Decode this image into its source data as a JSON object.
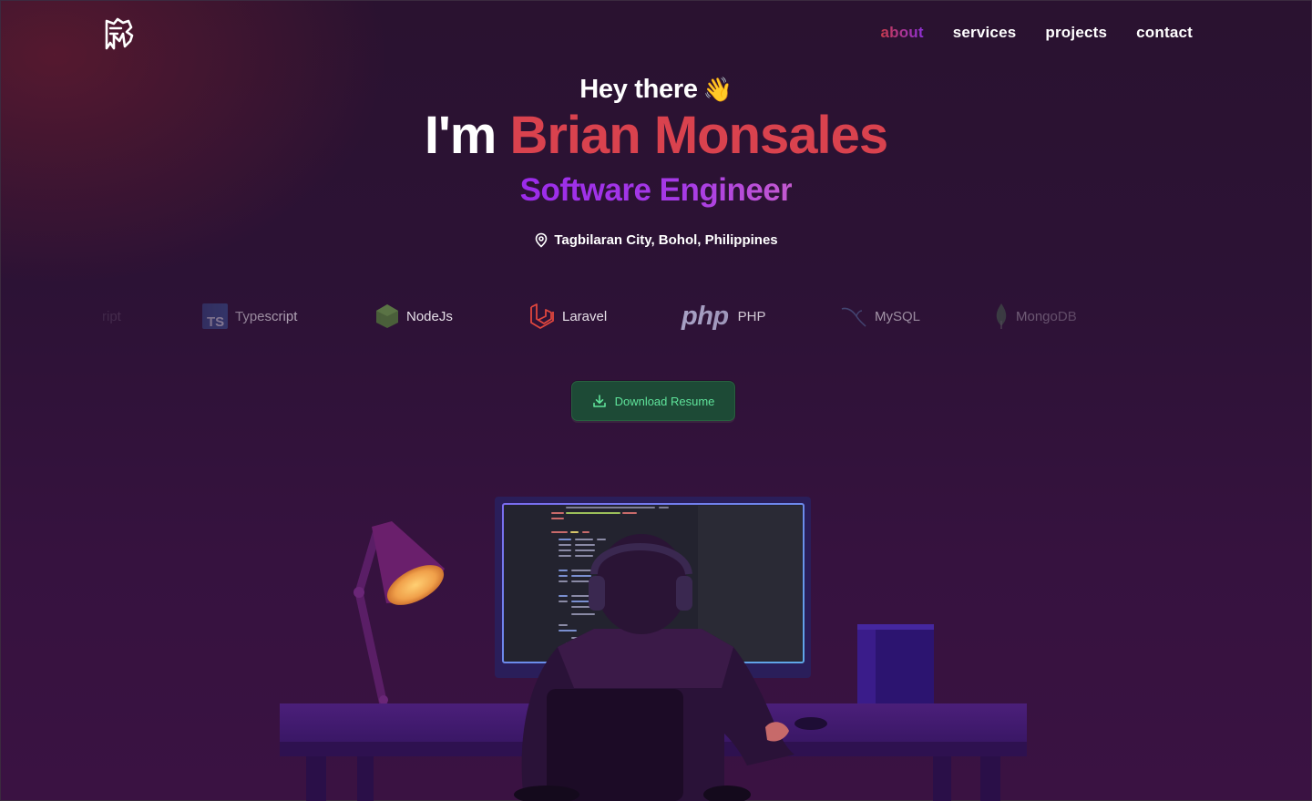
{
  "nav": {
    "items": [
      {
        "label": "about",
        "active": true
      },
      {
        "label": "services",
        "active": false
      },
      {
        "label": "projects",
        "active": false
      },
      {
        "label": "contact",
        "active": false
      }
    ]
  },
  "hero": {
    "greeting": "Hey there",
    "greeting_emoji": "👋",
    "intro": "I'm",
    "name": "Brian Monsales",
    "role": "Software Engineer",
    "location": "Tagbilaran City, Bohol, Philippines"
  },
  "tech_stack": [
    {
      "label": "ript",
      "icon": "javascript-icon"
    },
    {
      "label": "Typescript",
      "icon": "typescript-icon"
    },
    {
      "label": "NodeJs",
      "icon": "nodejs-icon"
    },
    {
      "label": "Laravel",
      "icon": "laravel-icon"
    },
    {
      "label": "PHP",
      "icon": "php-icon",
      "logo_text": "php"
    },
    {
      "label": "MySQL",
      "icon": "mysql-icon"
    },
    {
      "label": "MongoDB",
      "icon": "mongodb-icon"
    }
  ],
  "cta": {
    "label": "Download Resume",
    "icon": "download-icon"
  },
  "colors": {
    "accent_red": "#d9424e",
    "accent_purple": "#9b2bea",
    "button_bg": "#1d4a36",
    "button_text": "#5fe39a"
  }
}
